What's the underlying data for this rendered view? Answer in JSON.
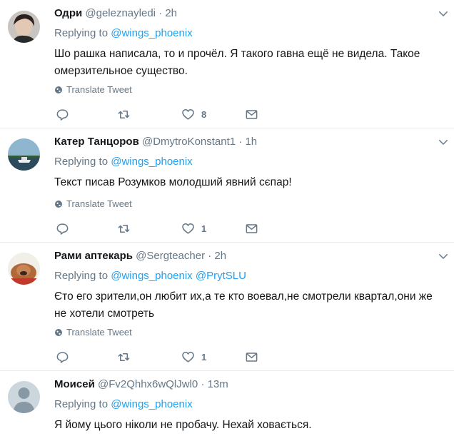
{
  "replying_prefix": "Replying to",
  "translate_label": "Translate Tweet",
  "tweets": [
    {
      "name": "Одри",
      "handle": "@geleznayledi",
      "time": "· 2h",
      "mentions": [
        "@wings_phoenix"
      ],
      "text": "Шо рашка написала, то и прочёл. Я такого гавна ещё не видела. Такое\nомерзительное существо.",
      "likes": "8"
    },
    {
      "name": "Катер Танцоров",
      "handle": "@DmytroKonstant1",
      "time": "· 1h",
      "mentions": [
        "@wings_phoenix"
      ],
      "text": "Текст писав Розумков молодший явний сєпар!",
      "likes": "1"
    },
    {
      "name": "Рами аптекарь",
      "handle": "@Sergteacher",
      "time": "· 2h",
      "mentions": [
        "@wings_phoenix",
        "@PrytSLU"
      ],
      "text": "Єто его зрители,он любит их,а те кто воевал,не смотрели квартал,они же\nне хотели смотреть",
      "likes": "1"
    },
    {
      "name": "Моисей",
      "handle": "@Fv2Qhhx6wQlJwl0",
      "time": "· 13m",
      "mentions": [
        "@wings_phoenix"
      ],
      "text": "Я йому цього ніколи не пробачу. Нехай ховається.",
      "likes": ""
    }
  ]
}
